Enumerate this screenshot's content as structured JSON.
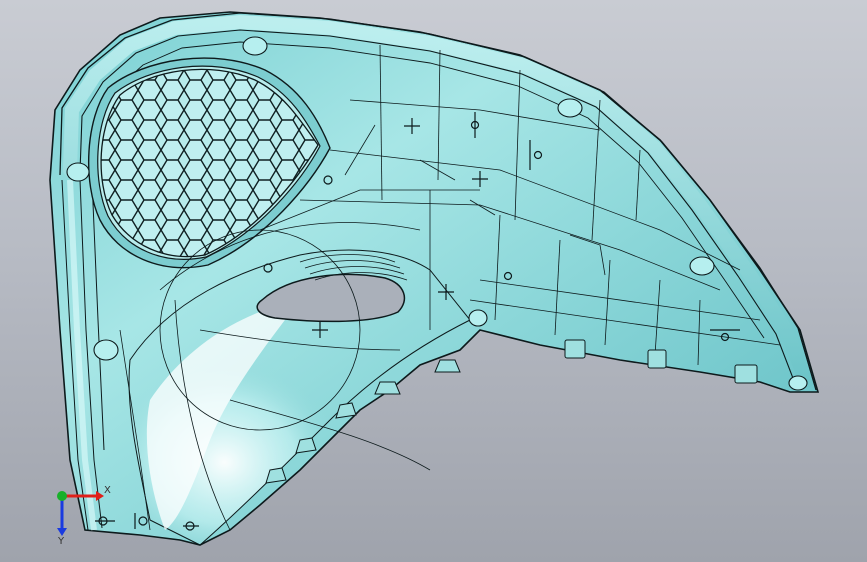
{
  "viewport": {
    "background_top": "#c9ccd3",
    "background_bottom": "#9fa3ac",
    "part_fill": "#8fd8d8",
    "part_highlight": "#eaffff",
    "part_shadow": "#3f9aa0",
    "edge_color": "#0d1a1c"
  },
  "triad": {
    "x_label": "X",
    "y_label": "Y",
    "x_color": "#e0201a",
    "y_color": "#1a3be0",
    "z_color": "#18b02a"
  }
}
